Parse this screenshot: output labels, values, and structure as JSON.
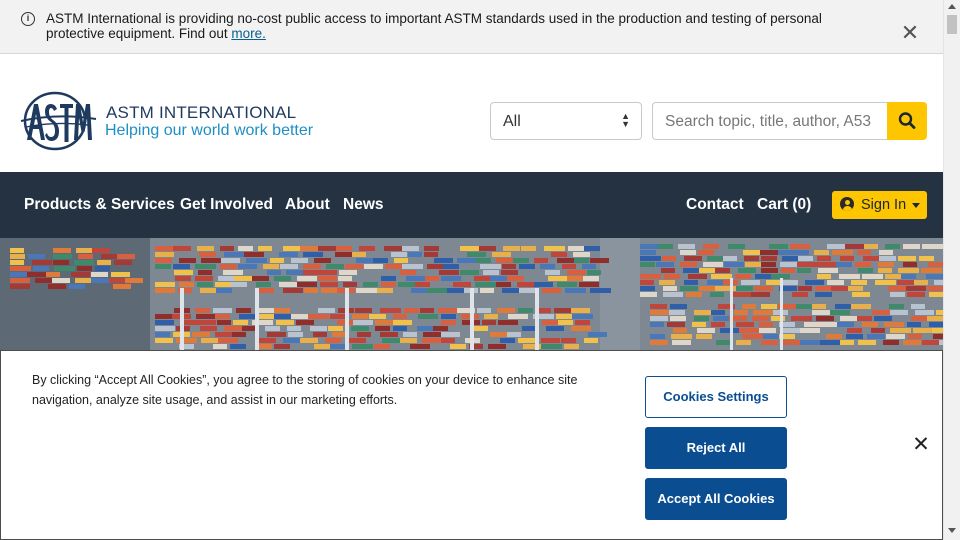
{
  "notice": {
    "message": "ASTM International is providing no-cost public access to important ASTM standards used in the production and testing of personal protective equipment. Find out",
    "link_text": "more.",
    "close_glyph": "✕",
    "info_glyph": "i"
  },
  "header": {
    "brand_name": "ASTM INTERNATIONAL",
    "tagline": "Helping our world work better",
    "scope_value": "All",
    "search_placeholder": "Search topic, title, author, A53"
  },
  "nav": {
    "left_items": [
      "Products & Services",
      "Get Involved",
      "About",
      "News"
    ],
    "contact": "Contact",
    "cart": "Cart (0)",
    "sign_in": "Sign In"
  },
  "cookie_banner": {
    "text": "By clicking “Accept All Cookies”, you agree to the storing of cookies on your device to enhance site navigation, analyze site usage, and assist in our marketing efforts.",
    "settings_label": "Cookies Settings",
    "reject_label": "Reject All",
    "accept_label": "Accept All Cookies",
    "close_glyph": "✕"
  },
  "colors": {
    "nav_background": "#253242",
    "accent_yellow": "#fdc600",
    "cookie_button_blue": "#0a4d91",
    "brand_navy": "#1f3a5f",
    "brand_blue": "#1e8fc4"
  },
  "icons": {
    "notice": "info-icon",
    "search": "search-icon",
    "sign_in": "user-circle-icon"
  }
}
